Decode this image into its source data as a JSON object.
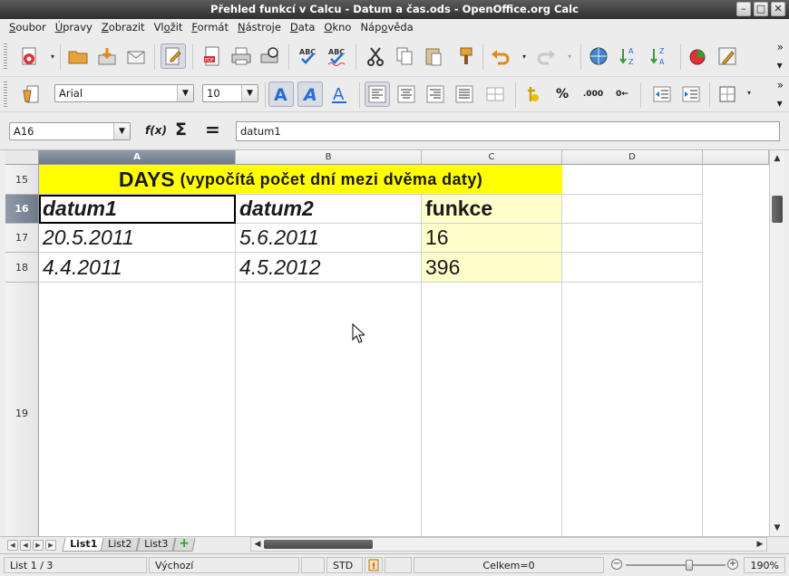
{
  "window": {
    "title": "Přehled funkcí v Calcu - Datum a čas.ods - OpenOffice.org Calc",
    "buttons": {
      "minimize": "–",
      "maximize": "□",
      "close": "✕"
    }
  },
  "menubar": {
    "items": [
      {
        "mnemonic": "S",
        "rest": "oubor"
      },
      {
        "mnemonic": "Ú",
        "rest": "pravy"
      },
      {
        "mnemonic": "Z",
        "rest": "obrazit"
      },
      {
        "pre": "Vl",
        "mnemonic": "o",
        "rest": "žit"
      },
      {
        "mnemonic": "F",
        "rest": "ormát"
      },
      {
        "mnemonic": "N",
        "rest": "ástroje"
      },
      {
        "mnemonic": "D",
        "rest": "ata"
      },
      {
        "mnemonic": "O",
        "rest": "kno"
      },
      {
        "pre": "Náp",
        "mnemonic": "o",
        "rest": "věda"
      }
    ]
  },
  "format_toolbar": {
    "font_name": "Arial",
    "font_size": "10",
    "percent_label": "%",
    "decimal_add_label": ".000",
    "decimal_del_label": "0←"
  },
  "formula_bar": {
    "name_box": "A16",
    "fx_label": "f(x)",
    "sum_label": "Σ",
    "equals_label": "=",
    "content": "datum1"
  },
  "grid": {
    "columns": [
      {
        "label": "A",
        "selected": true
      },
      {
        "label": "B",
        "selected": false
      },
      {
        "label": "C",
        "selected": false
      },
      {
        "label": "D",
        "selected": false
      },
      {
        "label": "",
        "selected": false
      }
    ],
    "rows": [
      {
        "label": "15",
        "selected": false
      },
      {
        "label": "16",
        "selected": true
      },
      {
        "label": "17",
        "selected": false
      },
      {
        "label": "18",
        "selected": false
      },
      {
        "label": "19",
        "selected": false
      }
    ],
    "title_main": "DAYS",
    "title_sub": "(vypočítá počet dní mezi dvěma daty)",
    "header_row": [
      "datum1",
      "datum2",
      "funkce"
    ],
    "data_rows": [
      [
        "20.5.2011",
        "5.6.2011",
        "16"
      ],
      [
        "4.4.2011",
        "4.5.2012",
        "396"
      ]
    ],
    "title_color": "#ffff00",
    "result_color": "#ffffcc"
  },
  "sheets": {
    "tabs": [
      "List1",
      "List2",
      "List3"
    ],
    "active": "List1",
    "add_label": "+"
  },
  "statusbar": {
    "sheet_info": "List 1 / 3",
    "page_style": "Výchozí",
    "mode": "STD",
    "sum": "Celkem=0",
    "zoom_minus": "−",
    "zoom_plus": "+",
    "zoom": "190%"
  }
}
